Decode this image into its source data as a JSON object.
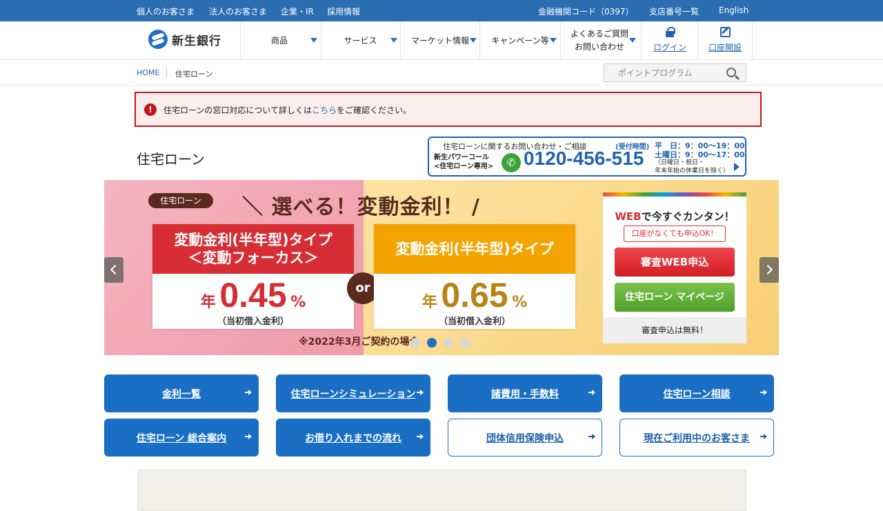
{
  "topbar": {
    "left_links": [
      "個人のお客さま",
      "法人のお客さま",
      "企業・IR",
      "採用情報"
    ],
    "right_links": [
      "金融機関コード（0397）",
      "支店番号一覧",
      "English"
    ]
  },
  "header": {
    "logo_text": "新生銀行",
    "nav": [
      "商品",
      "サービス",
      "マーケット情報",
      "キャンペーン等"
    ],
    "faq_line1": "よくあるご質問",
    "faq_line2": "お問い合わせ",
    "login": "ログイン",
    "open_account": "口座開設"
  },
  "breadcrumb": {
    "home": "HOME",
    "current": "住宅ローン"
  },
  "search": {
    "placeholder": "ポイントプログラム"
  },
  "notice": {
    "icon": "!",
    "text_before": "住宅ローンの窓口対応について詳しくは",
    "link": "こちら",
    "text_after": "をご確認ください。"
  },
  "page_title": "住宅ローン",
  "contact": {
    "heading": "住宅ローンに関するお問い合わせ・ご相談",
    "hours_label": "(受付時間)",
    "weekday_hours": "平　日：9：00～19：00",
    "saturday_hours": "土曜日：9：00～17：00",
    "name_line1": "新生パワーコール",
    "name_line2": "<住宅ローン専用>",
    "phone": "0120-456-515",
    "note_line1": "（日曜日・祝日・",
    "note_line2": "年末年始の休業日を除く）"
  },
  "hero": {
    "tag": "住宅ローン",
    "headline": "＼ 選べる！変動金利！ /",
    "card_a_title1": "変動金利(半年型)タイプ",
    "card_a_title2": "＜変動フォーカス＞",
    "card_a_year": "年",
    "card_a_rate": "0.45",
    "card_a_pct": "%",
    "card_a_sub": "（当初借入金利）",
    "or": "or",
    "card_b_title": "変動金利(半年型)タイプ",
    "card_b_year": "年",
    "card_b_rate": "0.65",
    "card_b_pct": "%",
    "card_b_sub": "（当初借入金利）",
    "note": "※2022年3月ご契約の場合",
    "slide_count": 4,
    "active_slide": 2
  },
  "apply": {
    "title_web": "WEB",
    "title_rest": "で今すぐカンタン！",
    "sub": "口座がなくても申込OK！",
    "btn_primary": "審査WEB申込",
    "btn_secondary": "住宅ローン マイページ",
    "footer": "審査申込は無料！"
  },
  "quick_links": [
    {
      "label": "金利一覧",
      "style": "solid"
    },
    {
      "label": "住宅ローンシミュレーション",
      "style": "solid"
    },
    {
      "label": "諸費用・手数料",
      "style": "solid"
    },
    {
      "label": "住宅ローン相談",
      "style": "solid"
    },
    {
      "label": "住宅ローン 総合案内",
      "style": "solid"
    },
    {
      "label": "お借り入れまでの流れ",
      "style": "solid"
    },
    {
      "label": "団体信用保険申込",
      "style": "outline"
    },
    {
      "label": "現在ご利用中のお客さま",
      "style": "outline"
    }
  ],
  "colors": {
    "brand_blue": "#2a6db1",
    "alert_red": "#c0171c",
    "rate_red": "#d72d34",
    "rate_gold": "#f3a400",
    "green": "#4ea02a"
  }
}
